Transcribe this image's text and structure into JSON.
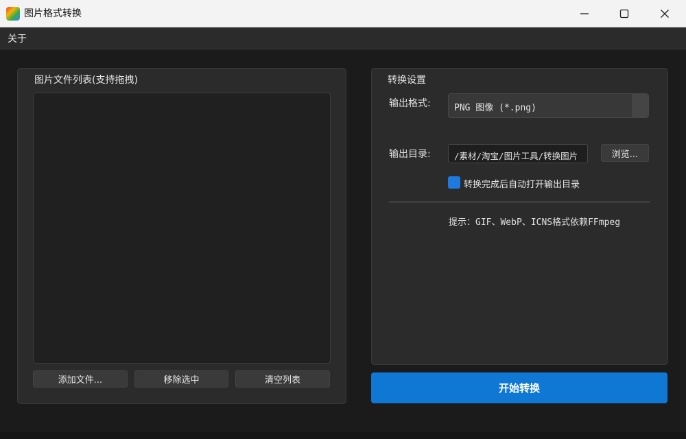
{
  "window": {
    "title": "图片格式转换"
  },
  "menubar": {
    "about": "关于"
  },
  "file_list": {
    "title": "图片文件列表(支持拖拽)",
    "add_label": "添加文件...",
    "remove_label": "移除选中",
    "clear_label": "清空列表"
  },
  "settings": {
    "title": "转换设置",
    "format_label": "输出格式:",
    "format_value": "PNG 图像 (*.png)",
    "dir_label": "输出目录:",
    "dir_value": "/素材/淘宝/图片工具/转换图片",
    "browse_label": "浏览...",
    "auto_open_label": "转换完成后自动打开输出目录",
    "auto_open_checked": true,
    "hint": "提示：GIF、WebP、ICNS格式依赖FFmpeg"
  },
  "start_label": "开始转换",
  "colors": {
    "accent": "#0f78d4",
    "background": "#1b1b1b",
    "panel": "#2b2b2b"
  }
}
